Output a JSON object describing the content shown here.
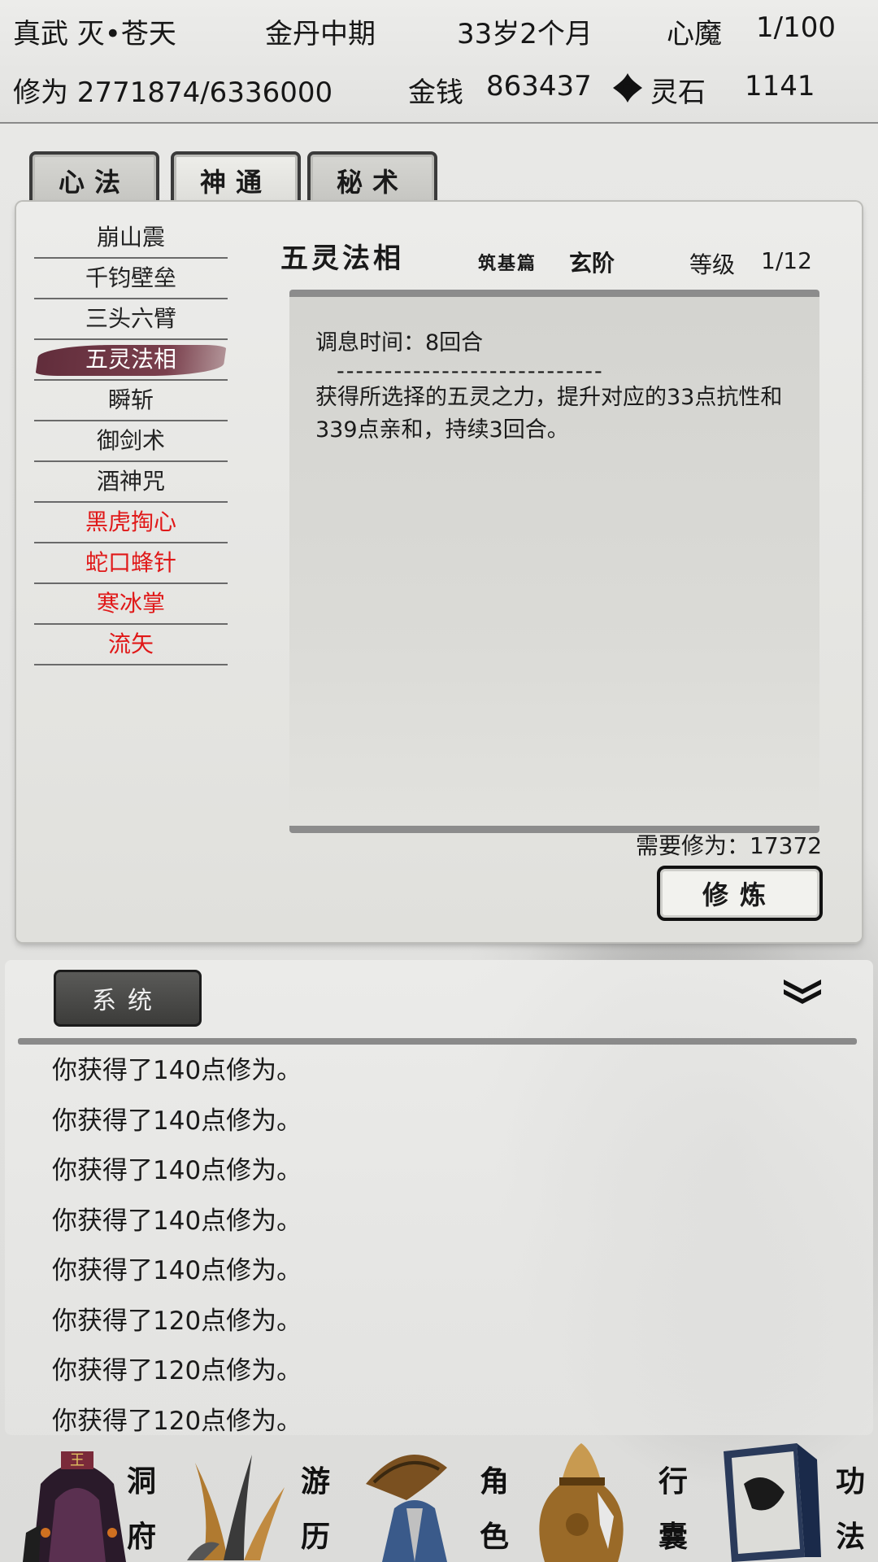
{
  "header": {
    "name": "真武 灭•苍天",
    "realm": "金丹中期",
    "age": "33岁2个月",
    "demon_label": "心魔",
    "demon_value": "1/100",
    "cultivation": "修为 2771874/6336000",
    "money_label": "金钱",
    "money_value": "863437",
    "spirit_stone_label": "灵石",
    "spirit_stone_value": "1141",
    "spirit_stone_icon": "spirit-stone-icon"
  },
  "tabs": [
    {
      "label": "心法",
      "active": false
    },
    {
      "label": "神通",
      "active": true
    },
    {
      "label": "秘术",
      "active": false
    }
  ],
  "skills": [
    {
      "label": "崩山震",
      "color": "normal"
    },
    {
      "label": "千钧壁垒",
      "color": "normal"
    },
    {
      "label": "三头六臂",
      "color": "normal"
    },
    {
      "label": "五灵法相",
      "color": "selected"
    },
    {
      "label": "瞬斩",
      "color": "normal"
    },
    {
      "label": "御剑术",
      "color": "normal"
    },
    {
      "label": "酒神咒",
      "color": "normal"
    },
    {
      "label": "黑虎掏心",
      "color": "red"
    },
    {
      "label": "蛇口蜂针",
      "color": "red"
    },
    {
      "label": "寒冰掌",
      "color": "red"
    },
    {
      "label": "流矢",
      "color": "red"
    }
  ],
  "detail": {
    "title": "五灵法相",
    "subtitle": "筑基篇",
    "tier": "玄阶",
    "level_label": "等级",
    "level_value": "1/12",
    "cooldown": "调息时间：8回合",
    "separator": "----------------------------",
    "description": "获得所选择的五灵之力，提升对应的33点抗性和339点亲和，持续3回合。",
    "required": "需要修为：17372",
    "train_button": "修炼"
  },
  "log": {
    "tab_label": "系统",
    "collapse_icon": "double-chevron-down-icon",
    "lines": [
      "你获得了140点修为。",
      "你获得了140点修为。",
      "你获得了140点修为。",
      "你获得了140点修为。",
      "你获得了140点修为。",
      "你获得了120点修为。",
      "你获得了120点修为。",
      "你获得了120点修为。"
    ]
  },
  "nav": {
    "items": [
      {
        "label1": "洞",
        "label2": "府",
        "icon": "cave-dwelling-icon"
      },
      {
        "label1": "游",
        "label2": "历",
        "icon": "travel-icon"
      },
      {
        "label1": "角",
        "label2": "色",
        "icon": "character-icon"
      },
      {
        "label1": "行",
        "label2": "囊",
        "icon": "inventory-bag-icon"
      },
      {
        "label1": "功",
        "label2": "法",
        "icon": "skills-book-icon"
      }
    ]
  },
  "colors": {
    "red_skill": "#e01818",
    "selected_brush": "#5a2332",
    "panel_bg": "#e6e6e2",
    "dark_tab": "#3c3c3a"
  }
}
